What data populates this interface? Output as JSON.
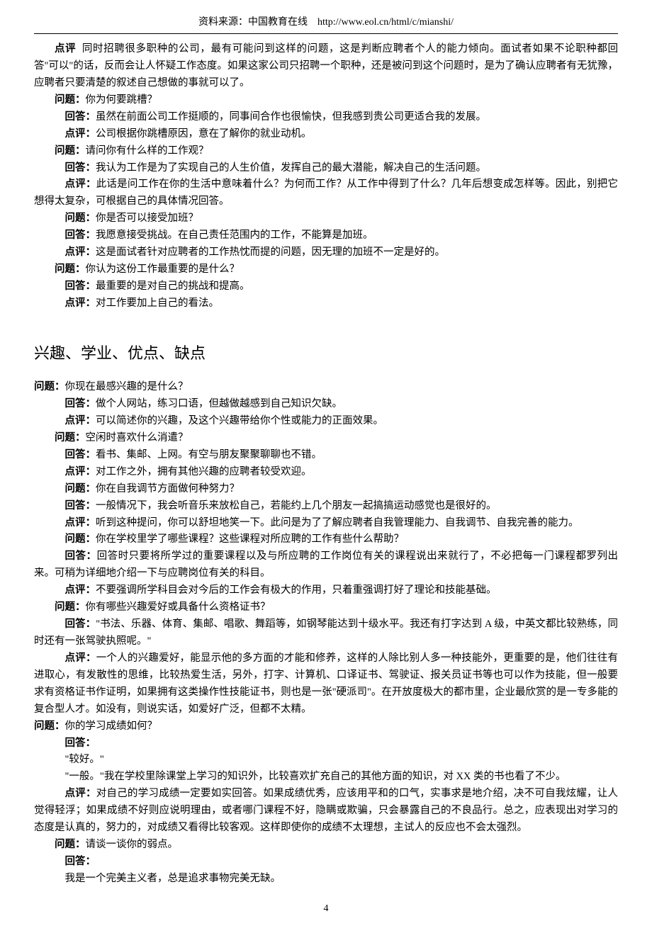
{
  "header": {
    "source_label": "资料来源：中国教育在线",
    "url": "http://www.eol.cn/html/c/mianshi/"
  },
  "top_paragraph": "同时招聘很多职种的公司，最有可能问到这样的问题，这是判断应聘者个人的能力倾向。面试者如果不论职种都回答\"可以\"的话，反而会让人怀疑工作态度。如果这家公司只招聘一个职种，还是被问到这个问题时，是为了确认应聘者有无犹豫，应聘者只要清楚的叙述自己想做的事就可以了。",
  "qa": [
    {
      "q_label": "问题：",
      "q": "你为何要跳槽？",
      "a_label": "回答：",
      "a": "虽然在前面公司工作挺顺的，同事间合作也很愉快，但我感到贵公司更适合我的发展。",
      "c_label": "点评：",
      "c": "公司根据你跳槽原因，意在了解你的就业动机。"
    },
    {
      "q_label": "问题：",
      "q": "请问你有什么样的工作观？",
      "a_label": "回答：",
      "a": "我认为工作是为了实现自己的人生价值，发挥自己的最大潜能，解决自己的生活问题。",
      "c_label": "点评：",
      "c": "此话是问工作在你的生活中意味着什么？为何而工作？从工作中得到了什么？几年后想变成怎样等。因此，别把它想得太复杂，可根据自己的具体情况回答。"
    },
    {
      "q_label": "问题：",
      "q": "你是否可以接受加班？",
      "a_label": "回答：",
      "a": "我愿意接受挑战。在自己责任范围内的工作，不能算是加班。",
      "c_label": "点评：",
      "c": "这是面试者针对应聘者的工作热忱而提的问题，因无理的加班不一定是好的。"
    },
    {
      "q_label": "问题：",
      "q": "你认为这份工作最重要的是什么？",
      "a_label": "回答：",
      "a": "最重要的是对自己的挑战和提高。",
      "c_label": "点评：",
      "c": "对工作要加上自己的看法。"
    }
  ],
  "section_title": "兴趣、学业、优点、缺点",
  "qa2": [
    {
      "q_label": "问题：",
      "q": "你现在最感兴趣的是什么？",
      "a_label": "回答：",
      "a": "做个人网站，练习口语，但越做越感到自己知识欠缺。",
      "c_label": "点评：",
      "c": "可以简述你的兴趣，及这个兴趣带给你个性或能力的正面效果。"
    },
    {
      "q_label": "问题：",
      "q": "空闲时喜欢什么消遣？",
      "a_label": "回答：",
      "a": "看书、集邮、上网。有空与朋友聚聚聊聊也不错。",
      "c_label": "点评：",
      "c": "对工作之外，拥有其他兴趣的应聘者较受欢迎。"
    },
    {
      "q_label": "问题：",
      "q": "你在自我调节方面做何种努力？",
      "a_label": "回答：",
      "a": "一般情况下，我会听音乐来放松自己，若能约上几个朋友一起搞搞运动感觉也是很好的。",
      "c_label": "点评：",
      "c": "听到这种提问，你可以舒坦地笑一下。此问是为了了解应聘者自我管理能力、自我调节、自我完善的能力。"
    },
    {
      "q_label": "问题：",
      "q": "你在学校里学了哪些课程？这些课程对所应聘的工作有些什么帮助？",
      "a_label": "回答：",
      "a": "回答时只要将所学过的重要课程以及与所应聘的工作岗位有关的课程说出来就行了，不必把每一门课程都罗列出来。可稍为详细地介绍一下与应聘岗位有关的科目。",
      "c_label": "点评：",
      "c": "不要强调所学科目会对今后的工作会有极大的作用，只着重强调打好了理论和技能基础。"
    },
    {
      "q_label": "问题：",
      "q": "你有哪些兴趣爱好或具备什么资格证书？",
      "a_label": "回答：",
      "a": "\"书法、乐器、体育、集邮、唱歌、舞蹈等，如钢琴能达到十级水平。我还有打字达到 A 级，中英文都比较熟练，同时还有一张驾驶执照呢。\"",
      "c_label": "点评：",
      "c": "一个人的兴趣爱好，能显示他的多方面的才能和修养，这样的人除比别人多一种技能外，更重要的是，他们往往有进取心，有发散性的思维，比较热爱生活，另外，打字、计算机、口译证书、驾驶证、报关员证书等也可以作为技能，但一般要求有资格证书作证明，如果拥有这类操作性技能证书，则也是一张\"硬派司\"。在开放度极大的都市里，企业最欣赏的是一专多能的复合型人才。如没有，则说实话，如爱好广泛，但都不太精。"
    }
  ],
  "qa3_q_label": "问题：",
  "qa3_q": "你的学习成绩如何？",
  "qa3_a_label": "回答：",
  "qa3_a_lines": [
    "\"较好。\"",
    "\"一般。\"我在学校里除课堂上学习的知识外，比较喜欢扩充自己的其他方面的知识，对 XX 类的书也看了不少。"
  ],
  "qa3_c_label": "点评：",
  "qa3_c": "对自己的学习成绩一定要如实回答。如果成绩优秀，应该用平和的口气，实事求是地介绍，决不可自我炫耀，让人觉得轻浮；如果成绩不好则应说明理由，或者哪门课程不好，隐瞒或欺骗，只会暴露自己的不良品行。总之，应表现出对学习的态度是认真的，努力的，对成绩又看得比较客观。这样即使你的成绩不太理想，主试人的反应也不会太强烈。",
  "qa4_q_label": "问题：",
  "qa4_q": "请谈一谈你的弱点。",
  "qa4_a_label": "回答：",
  "qa4_a": "我是一个完美主义者，总是追求事物完美无缺。",
  "page_number": "4"
}
